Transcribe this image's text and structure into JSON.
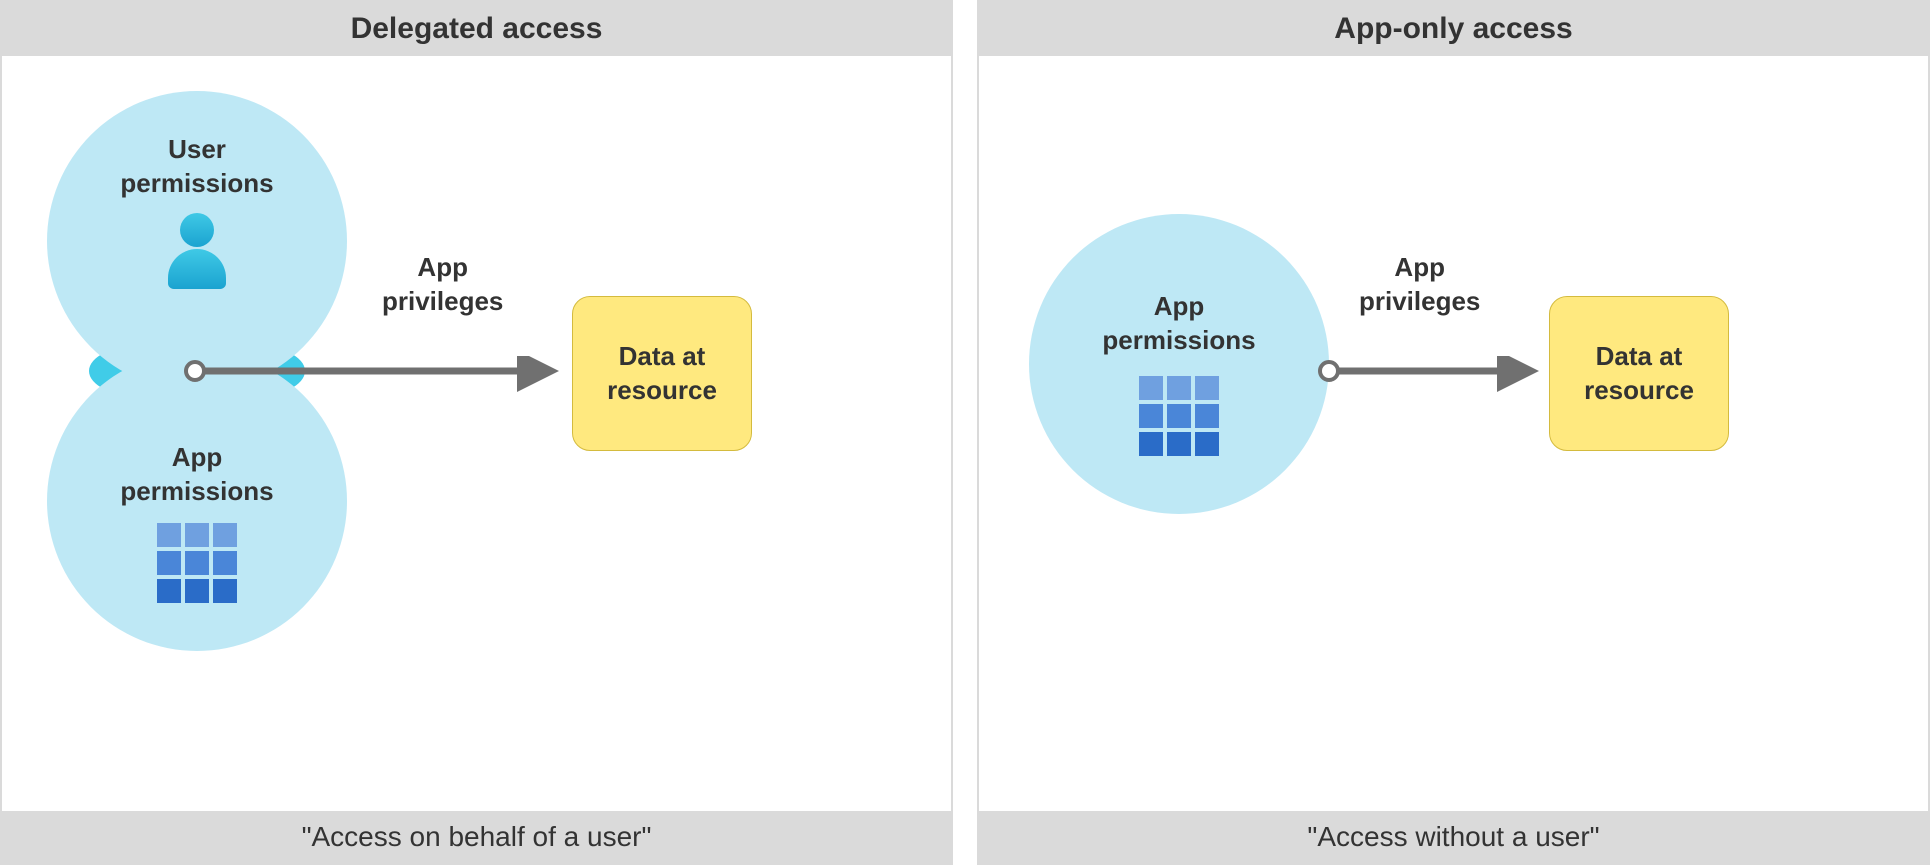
{
  "left": {
    "title": "Delegated access",
    "user_permissions_label": "User\npermissions",
    "app_permissions_label": "App\npermissions",
    "privileges_label": "App\nprivileges",
    "data_label": "Data at\nresource",
    "footer": "\"Access on behalf of a user\""
  },
  "right": {
    "title": "App-only access",
    "app_permissions_label": "App\npermissions",
    "privileges_label": "App\nprivileges",
    "data_label": "Data at\nresource",
    "footer": "\"Access without a user\""
  }
}
